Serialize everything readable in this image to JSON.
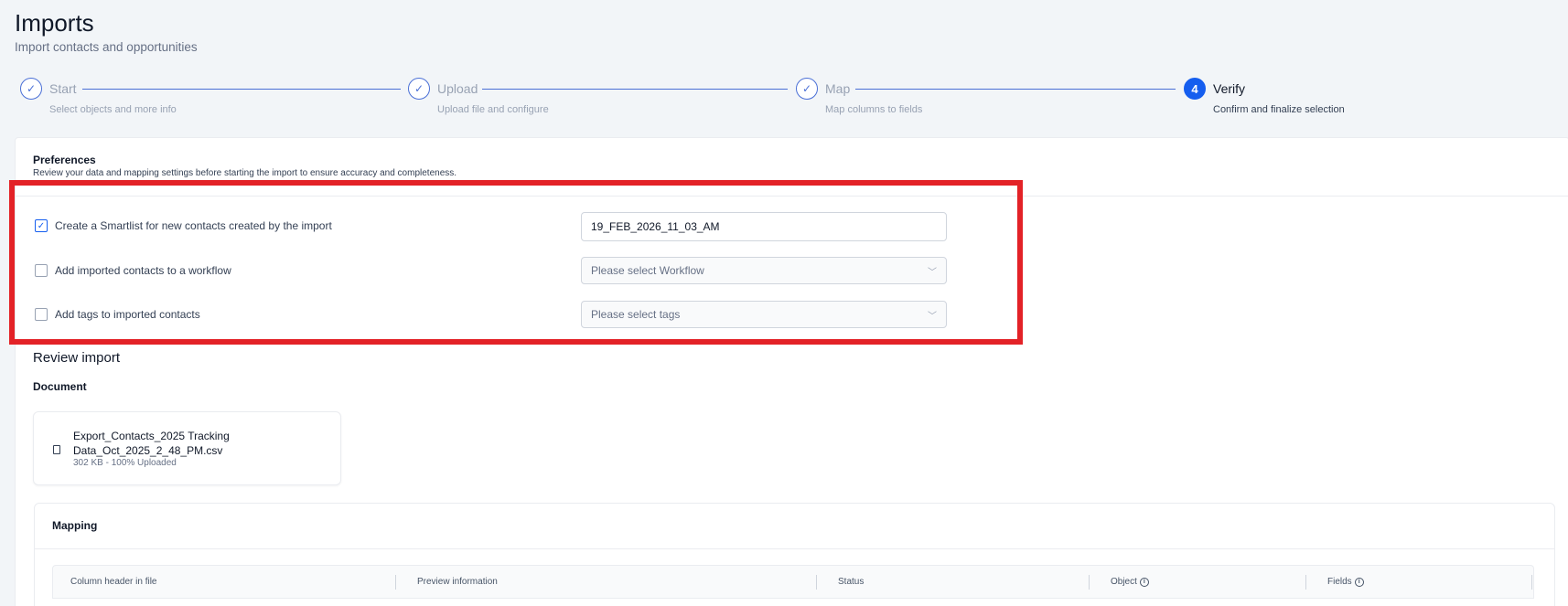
{
  "header": {
    "title": "Imports",
    "subtitle": "Import contacts and opportunities"
  },
  "stepper": {
    "steps": [
      {
        "marker": "✓",
        "label": "Start",
        "desc": "Select objects and more info"
      },
      {
        "marker": "✓",
        "label": "Upload",
        "desc": "Upload file and configure"
      },
      {
        "marker": "✓",
        "label": "Map",
        "desc": "Map columns to fields"
      },
      {
        "marker": "4",
        "label": "Verify",
        "desc": "Confirm and finalize selection"
      }
    ]
  },
  "preferences": {
    "title": "Preferences",
    "description": "Review your data and mapping settings before starting the import to ensure accuracy and completeness.",
    "smartlist": {
      "label": "Create a Smartlist for new contacts created by the import",
      "checked": true,
      "value": "19_FEB_2026_11_03_AM"
    },
    "workflow": {
      "label": "Add imported contacts to a workflow",
      "checked": false,
      "placeholder": "Please select Workflow"
    },
    "tags": {
      "label": "Add tags to imported contacts",
      "checked": false,
      "placeholder": "Please select tags"
    }
  },
  "review": {
    "title": "Review import",
    "document_title": "Document",
    "file_name": "Export_Contacts_2025 Tracking Data_Oct_2025_2_48_PM.csv",
    "file_meta": "302 KB - 100% Uploaded"
  },
  "mapping": {
    "title": "Mapping",
    "columns": [
      "Column header in file",
      "Preview information",
      "Status",
      "Object",
      "Fields"
    ]
  },
  "colors": {
    "accent": "#155eef",
    "highlight": "#e32227"
  }
}
